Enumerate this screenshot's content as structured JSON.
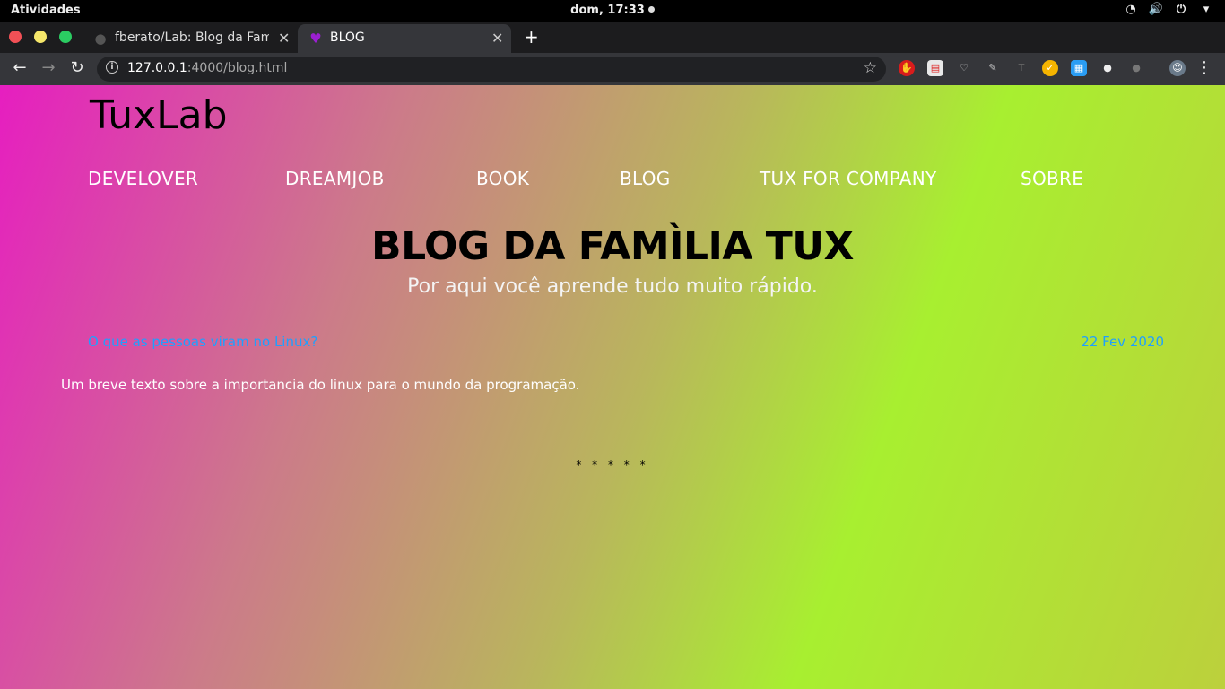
{
  "os_topbar": {
    "activities": "Atividades",
    "clock": "dom, 17:33"
  },
  "browser": {
    "tabs": [
      {
        "title": "fberato/Lab: Blog da Família",
        "favicon": "github-icon"
      },
      {
        "title": "BLOG",
        "favicon": "purple-heart-icon"
      }
    ],
    "url_host": "127.0.0.1",
    "url_path": ":4000/blog.html"
  },
  "page": {
    "brand": "TuxLab",
    "nav": [
      "DEVELOVER",
      "DREAMJOB",
      "BOOK",
      "BLOG",
      "TUX FOR COMPANY",
      "SOBRE"
    ],
    "title": "BLOG DA FAMÌLIA TUX",
    "subtitle": "Por aqui você aprende tudo muito rápido.",
    "post": {
      "title": "O que as pessoas viram no Linux?",
      "date": "22 Fev 2020",
      "excerpt": "Um breve texto sobre a importancia do linux para o mundo da programação."
    },
    "separator": "* * * * *"
  },
  "colors": {
    "link": "#1ea0ff",
    "gradient_start": "#e61ec0",
    "gradient_end": "#a8ef30"
  }
}
